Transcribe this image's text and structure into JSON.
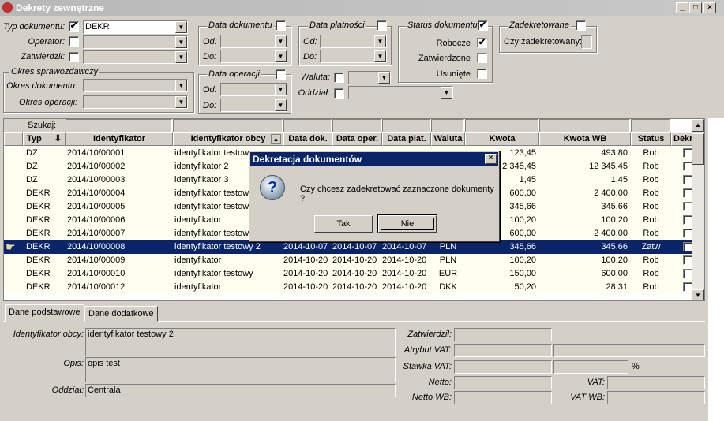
{
  "window": {
    "title": "Dekrety zewnętrzne"
  },
  "filters": {
    "typ_label": "Typ dokumentu:",
    "typ_value": "DEKR",
    "typ_checked": "✔",
    "operator_label": "Operator:",
    "zatwierdzil_label": "Zatwierdził:",
    "okres_group": "Okres sprawozdawczy",
    "okres_dok_label": "Okres dokumentu:",
    "okres_op_label": "Okres operacji:",
    "data_dok_group": "Data dokumentu",
    "data_op_group": "Data operacji",
    "data_plat_group": "Data płatności",
    "od_label": "Od:",
    "do_label": "Do:",
    "waluta_label": "Waluta:",
    "oddzial_label": "Oddział:",
    "status_group": "Status dokumentu",
    "status_checked": "✔",
    "robocze_label": "Robocze",
    "robocze_checked": "✔",
    "zatwierdzone_label": "Zatwierdzone",
    "usuniete_label": "Usunięte",
    "zadekretowane_group": "Zadekretowane",
    "czy_zadekretowany_label": "Czy zadekretowany:"
  },
  "grid": {
    "search_label": "Szukaj:",
    "columns": [
      "Typ",
      "Identyfikator",
      "Identyfikator obcy",
      "Data dok.",
      "Data oper.",
      "Data plat.",
      "Waluta",
      "Kwota",
      "Kwota WB",
      "Status",
      "Dekret"
    ],
    "rows": [
      {
        "typ": "DZ",
        "id": "2014/10/00001",
        "obcy": "identyfikator testowy",
        "ddok": "",
        "dop": "",
        "dplat": "",
        "wal": "",
        "kwota": "123,45",
        "kwb": "493,80",
        "status": "Rob"
      },
      {
        "typ": "DZ",
        "id": "2014/10/00002",
        "obcy": "identyfikator 2",
        "ddok": "",
        "dop": "",
        "dplat": "",
        "wal": "",
        "kwota": "2 345,45",
        "kwb": "12 345,45",
        "status": "Rob"
      },
      {
        "typ": "DZ",
        "id": "2014/10/00003",
        "obcy": "identyfikator 3",
        "ddok": "",
        "dop": "",
        "dplat": "",
        "wal": "",
        "kwota": "1,45",
        "kwb": "1,45",
        "status": "Rob"
      },
      {
        "typ": "DEKR",
        "id": "2014/10/00004",
        "obcy": "identyfikator testowy",
        "ddok": "",
        "dop": "",
        "dplat": "",
        "wal": "",
        "kwota": "600,00",
        "kwb": "2 400,00",
        "status": "Rob"
      },
      {
        "typ": "DEKR",
        "id": "2014/10/00005",
        "obcy": "identyfikator testowy",
        "ddok": "",
        "dop": "",
        "dplat": "",
        "wal": "",
        "kwota": "345,66",
        "kwb": "345,66",
        "status": "Rob"
      },
      {
        "typ": "DEKR",
        "id": "2014/10/00006",
        "obcy": "identyfikator",
        "ddok": "",
        "dop": "",
        "dplat": "",
        "wal": "",
        "kwota": "100,20",
        "kwb": "100,20",
        "status": "Rob"
      },
      {
        "typ": "DEKR",
        "id": "2014/10/00007",
        "obcy": "identyfikator testowy",
        "ddok": "",
        "dop": "",
        "dplat": "",
        "wal": "",
        "kwota": "600,00",
        "kwb": "2 400,00",
        "status": "Rob"
      },
      {
        "typ": "DEKR",
        "id": "2014/10/00008",
        "obcy": "identyfikator testowy 2",
        "ddok": "2014-10-07",
        "dop": "2014-10-07",
        "dplat": "2014-10-07",
        "wal": "PLN",
        "kwota": "345,66",
        "kwb": "345,66",
        "status": "Zatw"
      },
      {
        "typ": "DEKR",
        "id": "2014/10/00009",
        "obcy": "identyfikator",
        "ddok": "2014-10-20",
        "dop": "2014-10-20",
        "dplat": "2014-10-20",
        "wal": "PLN",
        "kwota": "100,20",
        "kwb": "100,20",
        "status": "Rob"
      },
      {
        "typ": "DEKR",
        "id": "2014/10/00010",
        "obcy": "identyfikator testowy",
        "ddok": "2014-10-20",
        "dop": "2014-10-20",
        "dplat": "2014-10-20",
        "wal": "EUR",
        "kwota": "150,00",
        "kwb": "600,00",
        "status": "Rob"
      },
      {
        "typ": "DEKR",
        "id": "2014/10/00012",
        "obcy": "identyfikator",
        "ddok": "2014-10-20",
        "dop": "2014-10-20",
        "dplat": "2014-10-20",
        "wal": "DKK",
        "kwota": "50,20",
        "kwb": "28,31",
        "status": "Rob"
      }
    ]
  },
  "tabs": [
    "Dane podstawowe",
    "Dane dodatkowe"
  ],
  "details": {
    "id_obcy_label": "Identyfikator obcy:",
    "id_obcy_value": "identyfikator testowy 2",
    "opis_label": "Opis:",
    "opis_value": "opis test",
    "oddzial_label": "Oddział:",
    "oddzial_value": "Centrala",
    "zatwierdzil_label": "Zatwierdził:",
    "atrybut_label": "Atrybut VAT:",
    "stawka_label": "Stawka VAT:",
    "percent": "%",
    "netto_label": "Netto:",
    "netto_wb_label": "Netto WB:",
    "vat_label": "VAT:",
    "vat_wb_label": "VAT WB:"
  },
  "dialog": {
    "title": "Dekretacja dokumentów",
    "message": "Czy chcesz zadekretować zaznaczone dokumenty ?",
    "yes": "Tak",
    "no": "Nie"
  }
}
